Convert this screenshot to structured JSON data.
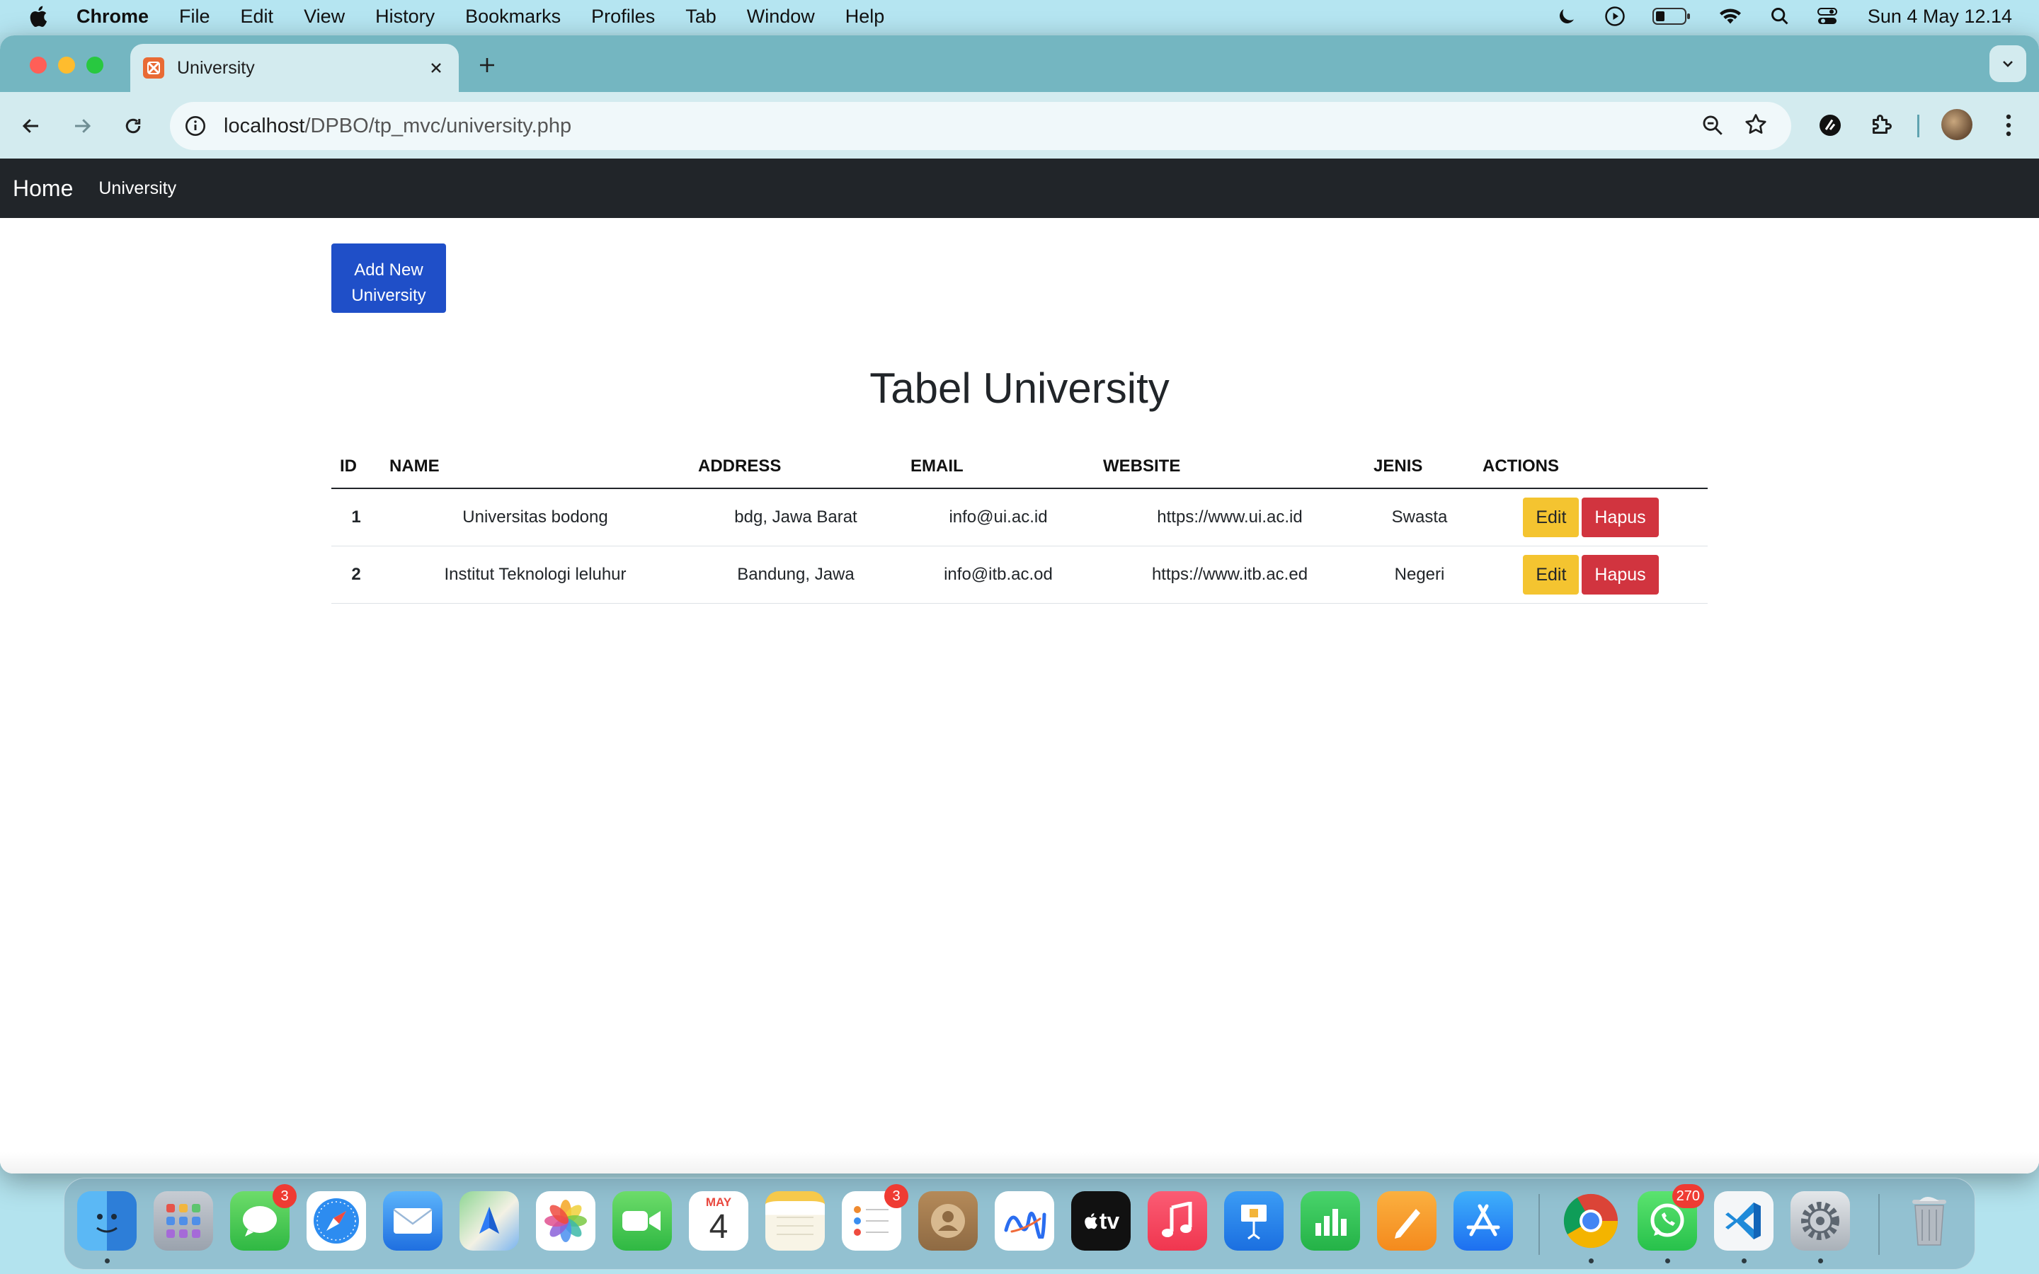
{
  "menubar": {
    "app_name": "Chrome",
    "menus": [
      "File",
      "Edit",
      "View",
      "History",
      "Bookmarks",
      "Profiles",
      "Tab",
      "Window",
      "Help"
    ],
    "clock": "Sun 4 May  12.14"
  },
  "browser": {
    "tab_title": "University",
    "url_host": "localhost",
    "url_path": "/DPBO/tp_mvc/university.php"
  },
  "site_nav": {
    "brand": "Home",
    "link": "University"
  },
  "page": {
    "add_button_line1": "Add New",
    "add_button_line2": "University",
    "title": "Tabel University",
    "columns": [
      "ID",
      "NAME",
      "ADDRESS",
      "EMAIL",
      "WEBSITE",
      "JENIS",
      "ACTIONS"
    ],
    "rows": [
      {
        "id": "1",
        "name": "Universitas bodong",
        "address": "bdg, Jawa Barat",
        "email": "info@ui.ac.id",
        "website": "https://www.ui.ac.id",
        "jenis": "Swasta",
        "edit": "Edit",
        "delete": "Hapus"
      },
      {
        "id": "2",
        "name": "Institut Teknologi leluhur",
        "address": "Bandung, Jawa",
        "email": "info@itb.ac.od",
        "website": "https://www.itb.ac.ed",
        "jenis": "Negeri",
        "edit": "Edit",
        "delete": "Hapus"
      }
    ]
  },
  "dock": {
    "messages_badge": "3",
    "calendar_month": "MAY",
    "calendar_day": "4",
    "reminders_badge": "3",
    "appletv_label": "tv",
    "whatsapp_badge": "270"
  },
  "colors": {
    "primary_button": "#1f4fc8",
    "edit_button": "#f4c430",
    "delete_button": "#d1343f",
    "navbar": "#212529",
    "tabstrip": "#74b6c1"
  }
}
